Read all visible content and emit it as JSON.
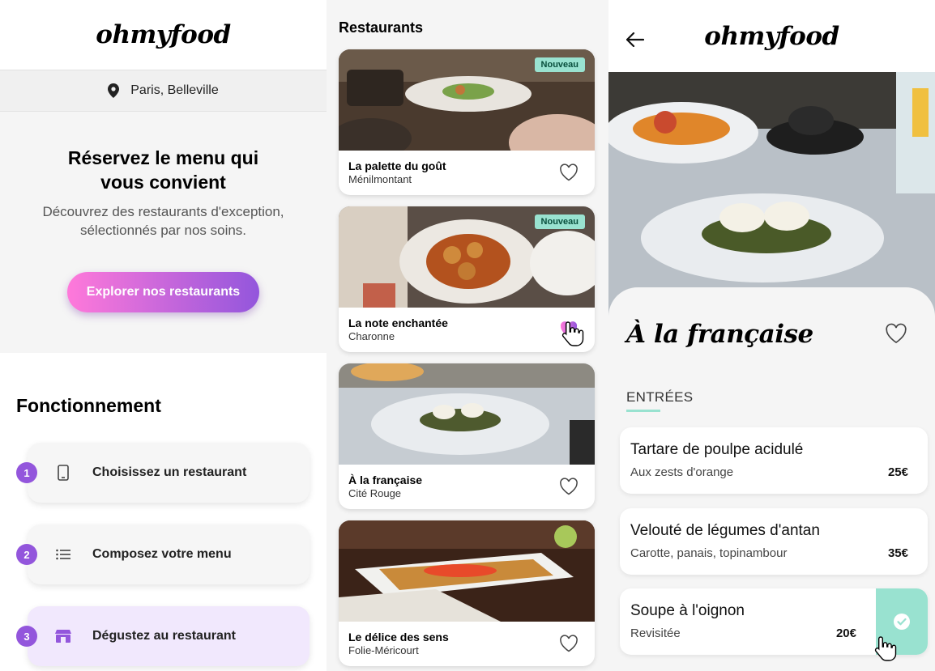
{
  "colors": {
    "primary": "#9356dc",
    "secondary": "#ff79da",
    "tertiary": "#99e2d0",
    "background": "#f5f5f5"
  },
  "home": {
    "logo": "ohmyfood",
    "location": "Paris, Belleville",
    "location_icon": "map-pin-icon",
    "hero_title": "Réservez le menu qui vous convient",
    "hero_subtitle_line1": "Découvrez des restaurants d'exception,",
    "hero_subtitle_line2": "sélectionnés par nos soins.",
    "cta_label": "Explorer nos restaurants",
    "how_title": "Fonctionnement",
    "steps": [
      {
        "number": "1",
        "icon": "smartphone-icon",
        "label": "Choisissez un restaurant",
        "active": false
      },
      {
        "number": "2",
        "icon": "list-icon",
        "label": "Composez votre menu",
        "active": false
      },
      {
        "number": "3",
        "icon": "store-icon",
        "label": "Dégustez au restaurant",
        "active": true
      }
    ]
  },
  "restaurants": {
    "title": "Restaurants",
    "items": [
      {
        "name": "La palette du goût",
        "area": "Ménilmontant",
        "badge": "Nouveau",
        "liked": false
      },
      {
        "name": "La note enchantée",
        "area": "Charonne",
        "badge": "Nouveau",
        "liked": true
      },
      {
        "name": "À la française",
        "area": "Cité Rouge",
        "badge": "",
        "liked": false
      },
      {
        "name": "Le délice des sens",
        "area": "Folie-Méricourt",
        "badge": "",
        "liked": false
      }
    ]
  },
  "menu": {
    "logo": "ohmyfood",
    "restaurant_name": "À la française",
    "section": "ENTRÉES",
    "dishes": [
      {
        "name": "Tartare de poulpe acidulé",
        "desc": "Aux zests d'orange",
        "price": "25€",
        "selected": false
      },
      {
        "name": "Velouté de légumes d'antan",
        "desc": "Carotte, panais, topinambour",
        "price": "35€",
        "selected": false
      },
      {
        "name": "Soupe à l'oignon",
        "desc": "Revisitée",
        "price": "20€",
        "selected": true
      }
    ]
  }
}
